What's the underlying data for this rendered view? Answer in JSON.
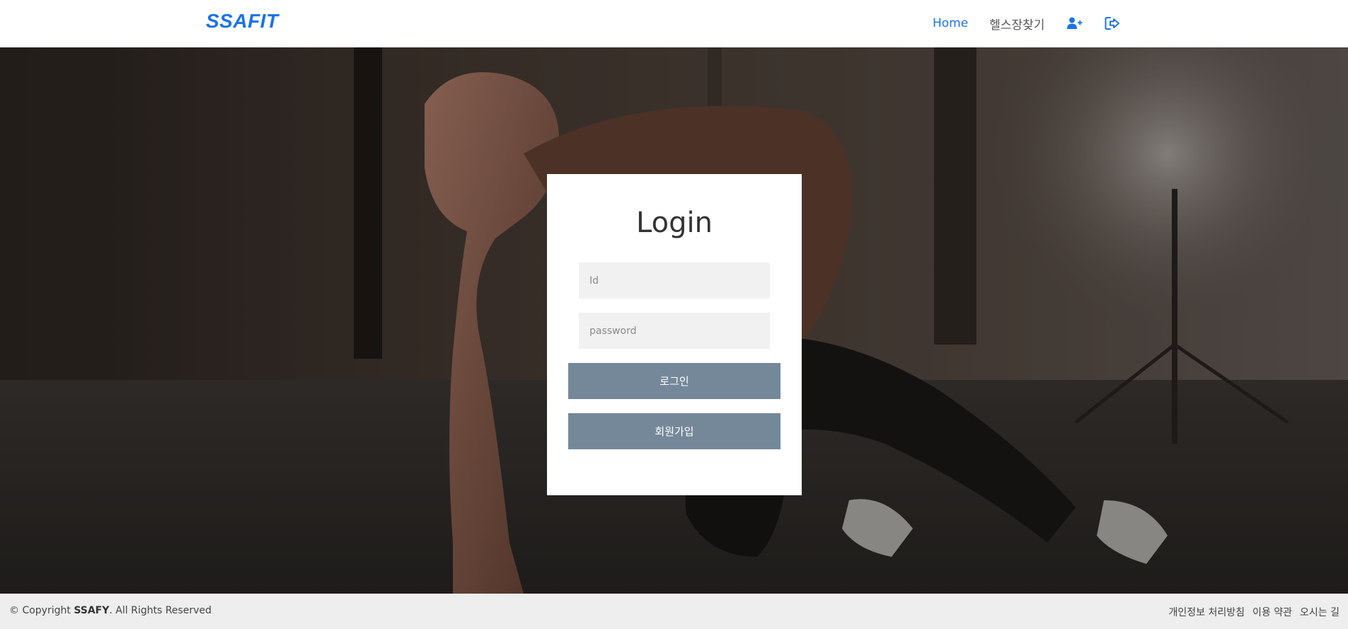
{
  "header": {
    "logo": "SSAFIT",
    "nav": {
      "home": "Home",
      "find_gym": "헬스장찾기"
    },
    "icons": {
      "signup": "user-plus-icon",
      "logout": "sign-out-icon"
    }
  },
  "login": {
    "title": "Login",
    "id_placeholder": "Id",
    "password_placeholder": "password",
    "login_button": "로그인",
    "signup_button": "회원가입"
  },
  "footer": {
    "copyright_prefix": "© Copyright ",
    "brand": "SSAFY",
    "copyright_suffix": ". All Rights Reserved",
    "links": [
      "개인정보 처리방침",
      "이용 약관",
      "오시는 길"
    ]
  },
  "colors": {
    "accent": "#1a73e8",
    "button": "#74889a",
    "input_bg": "#f1f1f1",
    "footer_bg": "#eeeeee"
  }
}
